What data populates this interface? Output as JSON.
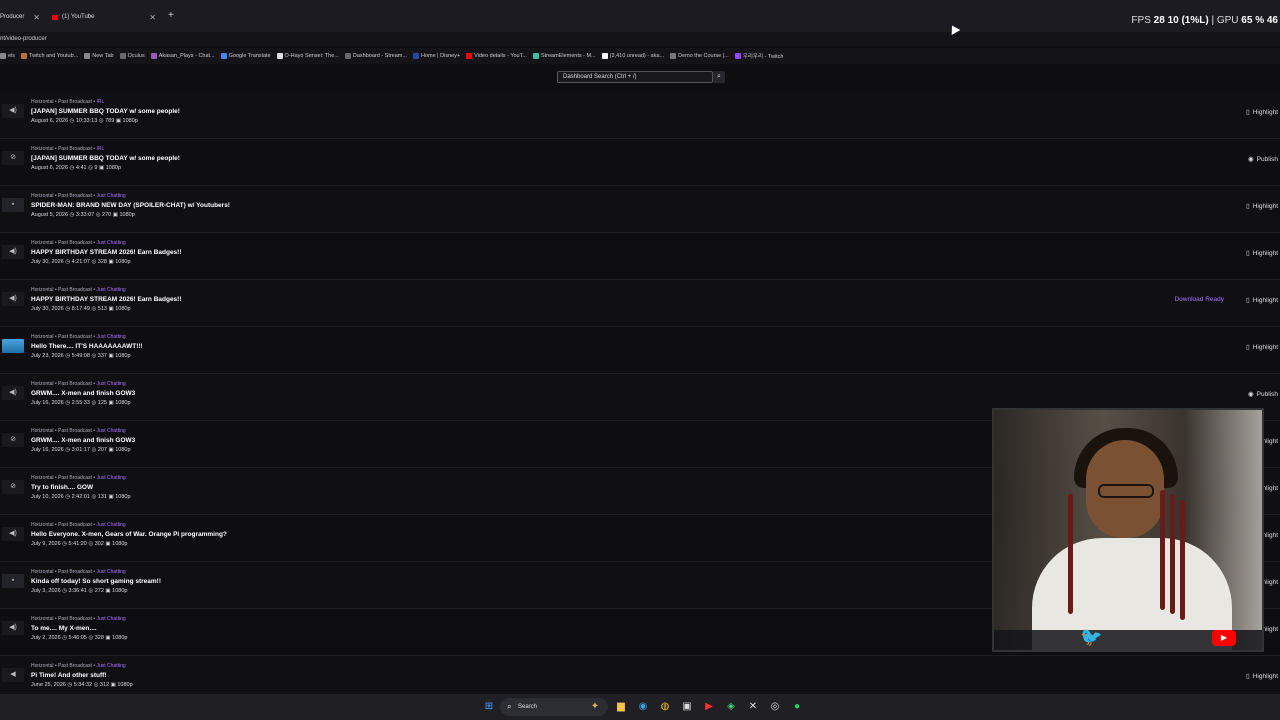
{
  "browser": {
    "tabs": [
      {
        "label": "Producer"
      },
      {
        "label": "(1) YouTube"
      }
    ],
    "url": "nt/video-producer",
    "hud": {
      "fps_label": "FPS",
      "fps": "28",
      "pct": "10 (1%L)",
      "gpu_label": "GPU",
      "gpu": "65 %",
      "tail": "46"
    },
    "bookmarks": [
      "els",
      "Twitch and Youtub...",
      "New Tab",
      "Oculus",
      "Akasan_Plays - Chat...",
      "Google Translate",
      "O-Hayo Sensei: The...",
      "Dashboard - Stream...",
      "Home | Disney+",
      "Video details - YouT...",
      "StreamElements - M...",
      "(3,410 unread) - aka...",
      "Demo the Course |...",
      "우리우리 - Twitch"
    ]
  },
  "search": {
    "placeholder": "Dashboard Search (Ctrl + /)"
  },
  "videos": [
    {
      "meta_prefix": "Horizontal • Past Broadcast • ",
      "category": "IRL",
      "title": "[JAPAN] SUMMER BBQ TODAY w/ some people!",
      "info": "August 6, 2026  ◷ 10:33:13  ◎ 789  ▣ 1080p",
      "action": "Highlight",
      "thumb": "◀)",
      "ready": ""
    },
    {
      "meta_prefix": "Horizontal • Past Broadcast • ",
      "category": "IRL",
      "title": "[JAPAN] SUMMER BBQ TODAY w/ some people!",
      "info": "August 6, 2026  ◷ 4:41  ◎ 9  ▣ 1080p",
      "action": "Publish",
      "thumb": "⊘",
      "ready": ""
    },
    {
      "meta_prefix": "Horizontal • Past Broadcast • ",
      "category": "Just Chatting",
      "title": "SPIDER-MAN: BRAND NEW DAY (SPOILER-CHAT) w/ Youtubers!",
      "info": "August 5, 2026  ◷ 3:33:07  ◎ 270  ▣ 1080p",
      "action": "Highlight",
      "thumb": "▪",
      "ready": ""
    },
    {
      "meta_prefix": "Horizontal • Past Broadcast • ",
      "category": "Just Chatting",
      "title": "HAPPY BIRTHDAY STREAM 2026! Earn Badges!!",
      "info": "July 30, 2026  ◷ 4:21:07  ◎ 328  ▣ 1080p",
      "action": "Highlight",
      "thumb": "◀)",
      "ready": ""
    },
    {
      "meta_prefix": "Horizontal • Past Broadcast • ",
      "category": "Just Chatting",
      "title": "HAPPY BIRTHDAY STREAM 2026! Earn Badges!!",
      "info": "July 30, 2026  ◷ 8:17:49  ◎ 513  ▣ 1080p",
      "action": "Highlight",
      "thumb": "◀)",
      "ready": "Download Ready"
    },
    {
      "meta_prefix": "Horizontal • Past Broadcast • ",
      "category": "Just Chatting",
      "title": "Hello There.... IT'S HAAAAAAAWT!!!",
      "info": "July 23, 2026  ◷ 5:49:08  ◎ 337  ▣ 1080p",
      "action": "Highlight",
      "thumb": "",
      "ready": ""
    },
    {
      "meta_prefix": "Horizontal • Past Broadcast • ",
      "category": "Just Chatting",
      "title": "GRWM.... X-men and finish GOW3",
      "info": "July 16, 2026  ◷ 2:55:33  ◎ 125  ▣ 1080p",
      "action": "Publish",
      "thumb": "◀)",
      "ready": ""
    },
    {
      "meta_prefix": "Horizontal • Past Broadcast • ",
      "category": "Just Chatting",
      "title": "GRWM.... X-men and finish GOW3",
      "info": "July 16, 2026  ◷ 3:01:17  ◎ 207  ▣ 1080p",
      "action": "Highlight",
      "thumb": "⊘",
      "ready": ""
    },
    {
      "meta_prefix": "Horizontal • Past Broadcast • ",
      "category": "Just Chatting",
      "title": "Try to finish.... GOW",
      "info": "July 10, 2026  ◷ 2:42:01  ◎ 131  ▣ 1080p",
      "action": "Highlight",
      "thumb": "⊘",
      "ready": ""
    },
    {
      "meta_prefix": "Horizontal • Past Broadcast • ",
      "category": "Just Chatting",
      "title": "Hello Everyone. X-men, Gears of War. Orange Pi programming?",
      "info": "July 9, 2026  ◷ 5:41:20  ◎ 302  ▣ 1080p",
      "action": "Highlight",
      "thumb": "◀)",
      "ready": ""
    },
    {
      "meta_prefix": "Horizontal • Past Broadcast • ",
      "category": "Just Chatting",
      "title": "Kinda off today! So short gaming stream!!",
      "info": "July 3, 2026  ◷ 3:36:41  ◎ 272  ▣ 1080p",
      "action": "Highlight",
      "thumb": "▪",
      "ready": ""
    },
    {
      "meta_prefix": "Horizontal • Past Broadcast • ",
      "category": "Just Chatting",
      "title": "To me.... My X-men....",
      "info": "July 2, 2026  ◷ 5:46:05  ◎ 328  ▣ 1080p",
      "action": "Highlight",
      "thumb": "◀)",
      "ready": ""
    },
    {
      "meta_prefix": "Horizontal • Past Broadcast • ",
      "category": "Just Chatting",
      "title": "Pi Time! And other stuff!",
      "info": "June 25, 2026  ◷ 5:34:32  ◎ 312  ▣ 1080p",
      "action": "Highlight",
      "thumb": "◀",
      "ready": ""
    }
  ],
  "taskbar": {
    "search_label": "Search"
  }
}
